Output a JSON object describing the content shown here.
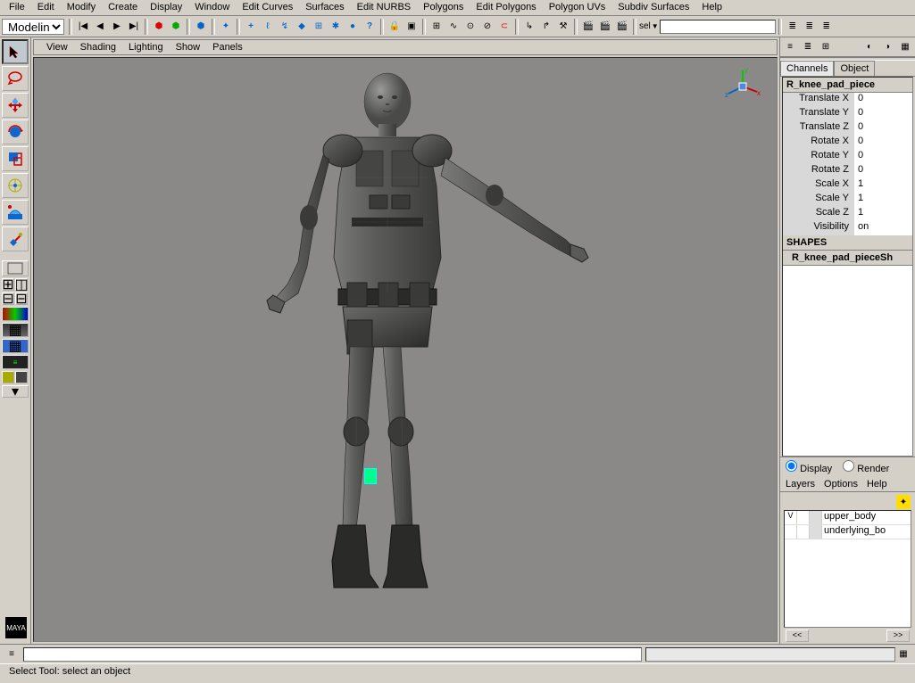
{
  "menubar": [
    "File",
    "Edit",
    "Modify",
    "Create",
    "Display",
    "Window",
    "Edit Curves",
    "Surfaces",
    "Edit NURBS",
    "Polygons",
    "Edit Polygons",
    "Polygon UVs",
    "Subdiv Surfaces",
    "Help"
  ],
  "mode": "Modeling",
  "sel_label": "sel",
  "vp_menu": [
    "View",
    "Shading",
    "Lighting",
    "Show",
    "Panels"
  ],
  "channels_tab": "Channels",
  "object_tab": "Object",
  "selected_object": "R_knee_pad_piece",
  "channels": [
    {
      "label": "Translate X",
      "val": "0"
    },
    {
      "label": "Translate Y",
      "val": "0"
    },
    {
      "label": "Translate Z",
      "val": "0"
    },
    {
      "label": "Rotate X",
      "val": "0"
    },
    {
      "label": "Rotate Y",
      "val": "0"
    },
    {
      "label": "Rotate Z",
      "val": "0"
    },
    {
      "label": "Scale X",
      "val": "1"
    },
    {
      "label": "Scale Y",
      "val": "1"
    },
    {
      "label": "Scale Z",
      "val": "1"
    },
    {
      "label": "Visibility",
      "val": "on"
    }
  ],
  "shapes_header": "SHAPES",
  "shape_name": "R_knee_pad_pieceSh",
  "display_radio": "Display",
  "render_radio": "Render",
  "layer_menu": [
    "Layers",
    "Options",
    "Help"
  ],
  "layers": [
    {
      "vis": "V",
      "name": "upper_body"
    },
    {
      "vis": "",
      "name": "underlying_bo"
    }
  ],
  "scroll_left": "<<",
  "scroll_right": ">>",
  "status": "Select Tool: select an object",
  "logo": "MAYA",
  "axis": {
    "x": "x",
    "y": "y",
    "z": "z"
  },
  "colors": {
    "bg": "#d4d0c8",
    "vp": "#8a8987",
    "highlight": "#0f8"
  }
}
